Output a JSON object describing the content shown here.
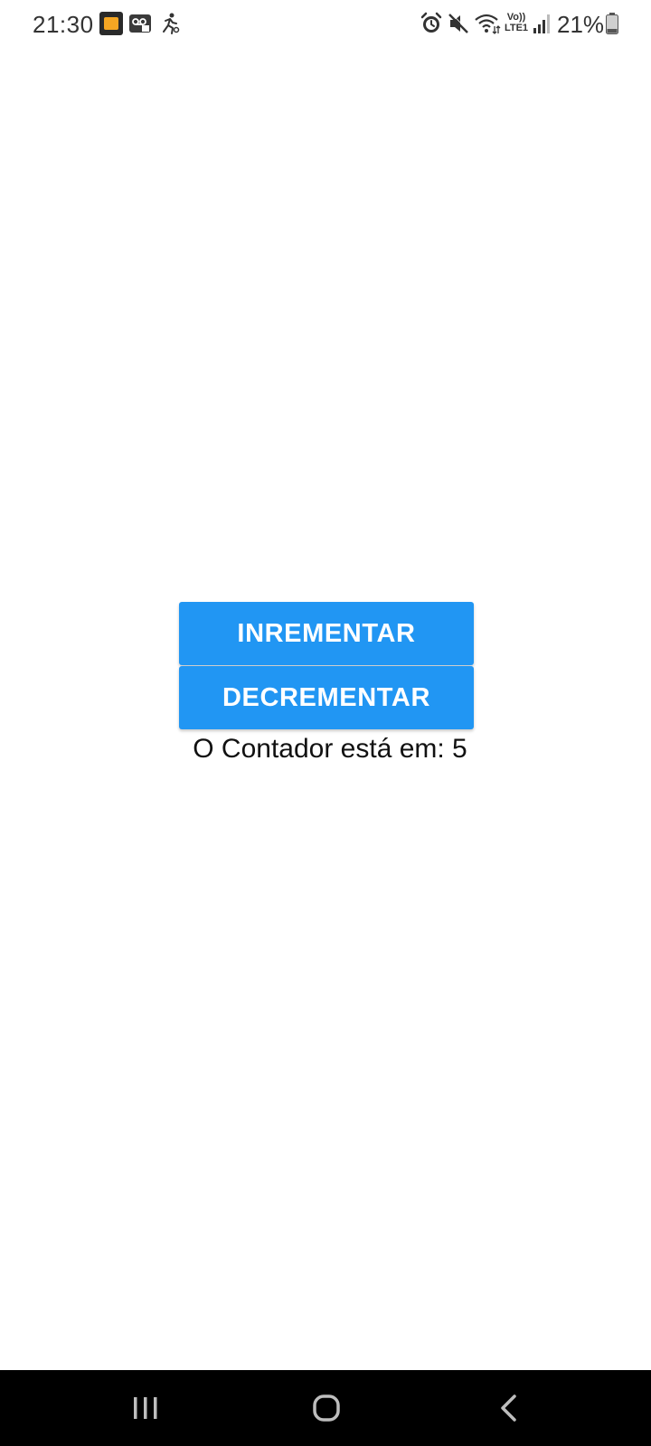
{
  "status_bar": {
    "time": "21:30",
    "volte_top": "Vo))",
    "volte_bottom": "LTE1",
    "battery_percent": "21%",
    "icons": [
      "notification-app-icon",
      "voicemail-icon",
      "running-icon",
      "alarm-icon",
      "mute-icon",
      "wifi-icon",
      "volte-icon",
      "signal-icon",
      "battery-icon"
    ]
  },
  "main": {
    "increment_label": "INREMENTAR",
    "decrement_label": "DECREMENTAR",
    "counter_text": "O Contador está em: 5"
  },
  "nav_bar": {
    "icons": [
      "recents-icon",
      "home-icon",
      "back-icon"
    ]
  },
  "colors": {
    "button": "#2196f3",
    "button_text": "#ffffff",
    "nav_bar": "#000000"
  }
}
